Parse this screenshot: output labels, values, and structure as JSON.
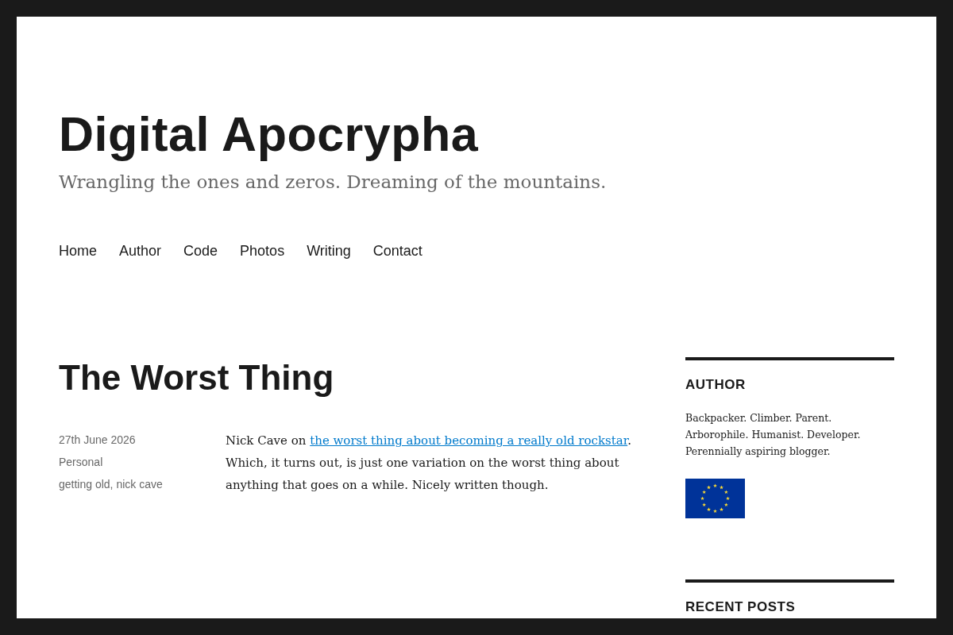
{
  "site": {
    "title": "Digital Apocrypha",
    "tagline": "Wrangling the ones and zeros. Dreaming of the mountains."
  },
  "nav": [
    "Home",
    "Author",
    "Code",
    "Photos",
    "Writing",
    "Contact"
  ],
  "post": {
    "title": "The Worst Thing",
    "date": "27th June 2026",
    "category": "Personal",
    "tags": "getting old, nick cave",
    "excerpt": {
      "before": "Nick Cave on ",
      "link": "the worst thing about becoming a really old rockstar",
      "after": ". Which, it turns out, is just one variation on the worst thing about anything that goes on a while. Nicely written though."
    }
  },
  "sidebar": {
    "widgets": [
      {
        "kind": "bio",
        "title": "AUTHOR",
        "text": "Backpacker. Climber. Parent. Arborophile. Humanist. Developer. Perennially aspiring blogger."
      },
      {
        "kind": "posts",
        "title": "RECENT POSTS"
      }
    ]
  }
}
